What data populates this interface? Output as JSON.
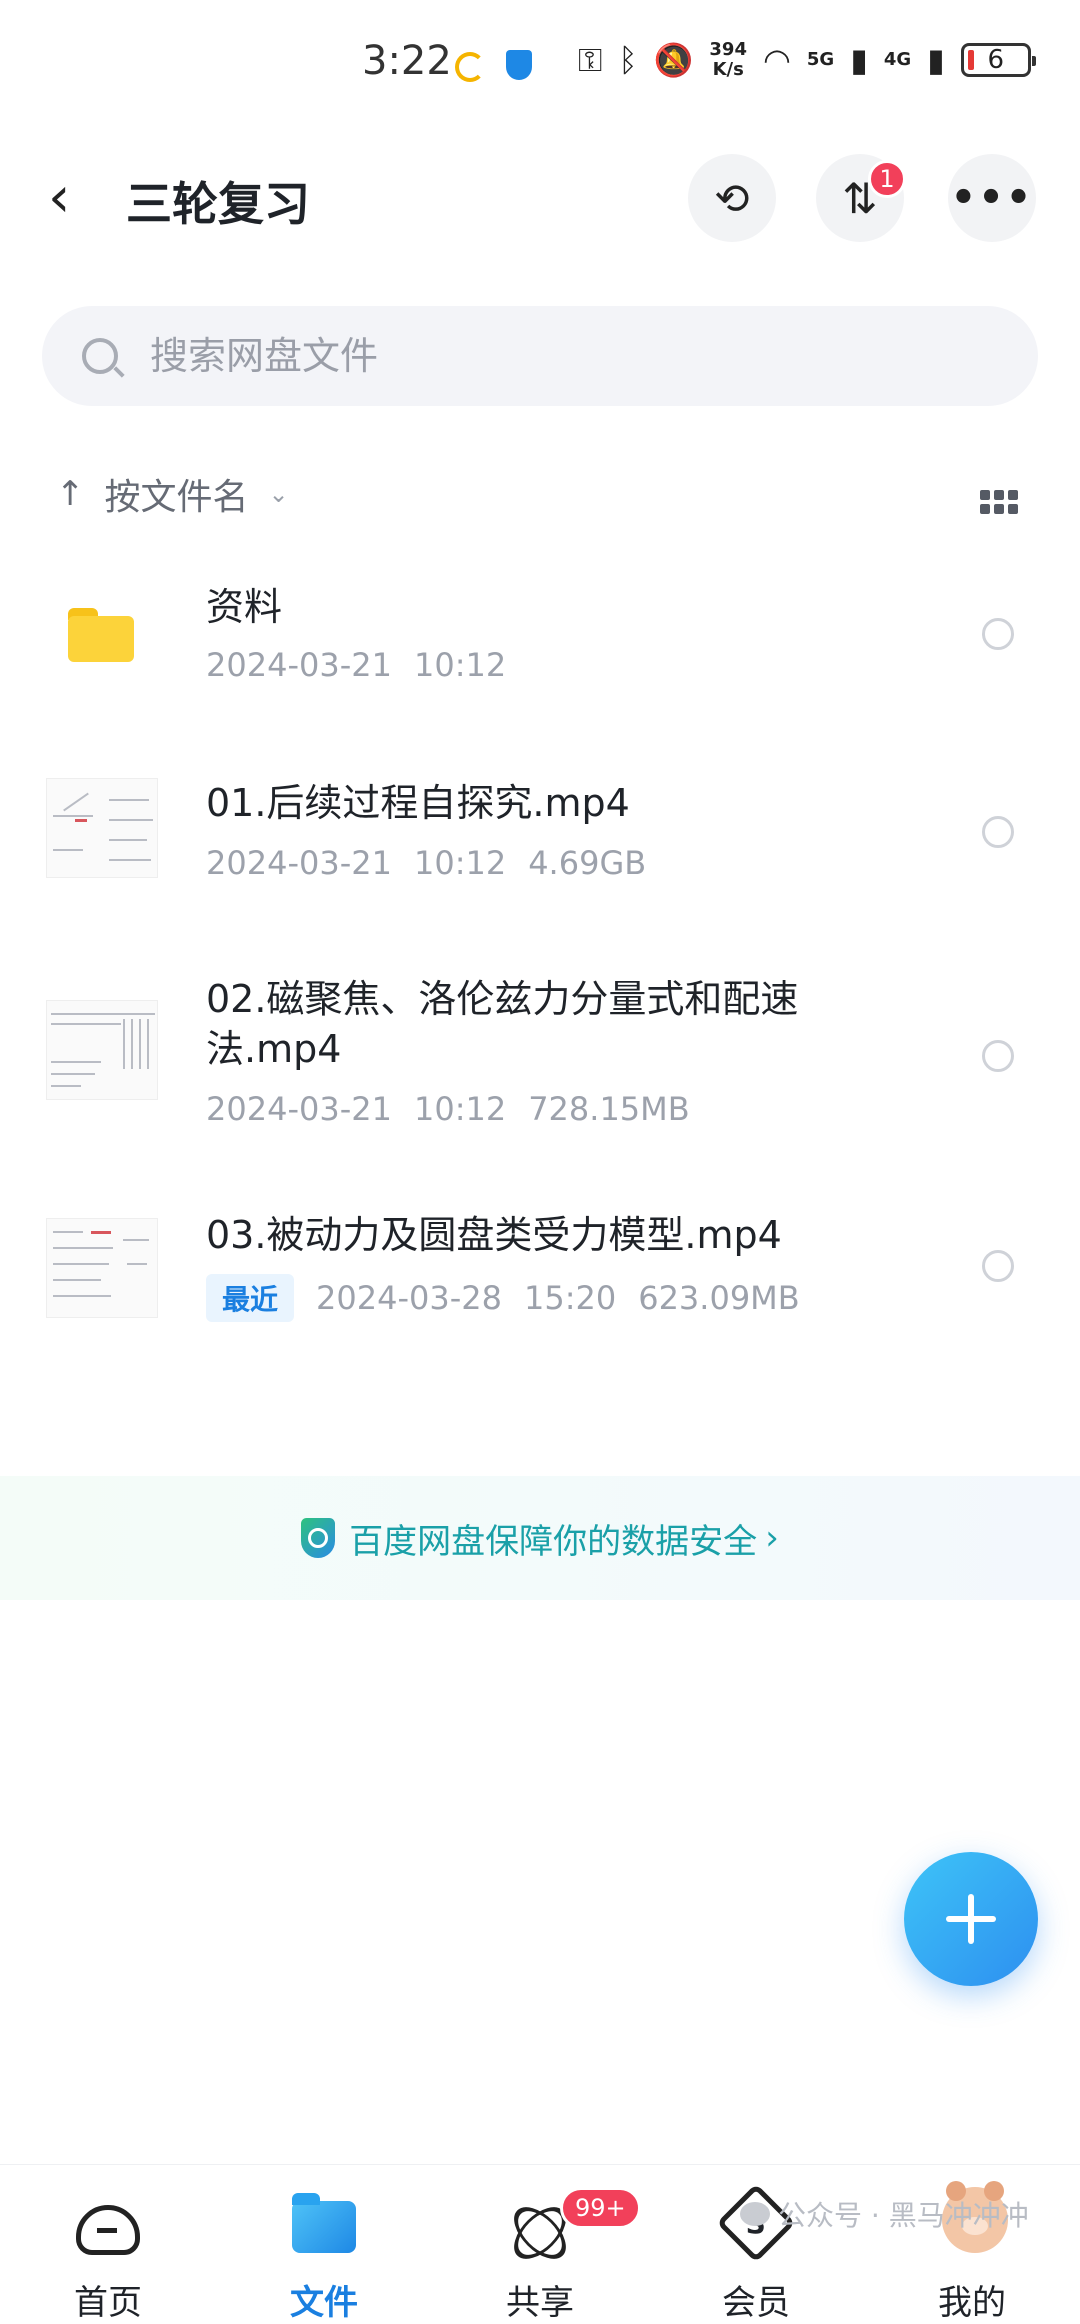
{
  "status_bar": {
    "time": "3:22",
    "net_speed_value": "394",
    "net_speed_unit": "K/s",
    "signal_1": "5G",
    "signal_2": "4G",
    "battery": "6"
  },
  "header": {
    "title": "三轮复习",
    "transfer_badge": "1",
    "more_label": "•••"
  },
  "search": {
    "placeholder": "搜索网盘文件"
  },
  "sort": {
    "label": "按文件名",
    "arrow": "↑",
    "chevron": "⌄"
  },
  "files": [
    {
      "name": "资料",
      "date": "2024-03-21",
      "time": "10:12",
      "size": "",
      "tag": ""
    },
    {
      "name": "01.后续过程自探究.mp4",
      "date": "2024-03-21",
      "time": "10:12",
      "size": "4.69GB",
      "tag": ""
    },
    {
      "name": "02.磁聚焦、洛伦兹力分量式和配速法.mp4",
      "date": "2024-03-21",
      "time": "10:12",
      "size": "728.15MB",
      "tag": ""
    },
    {
      "name": "03.被动力及圆盘类受力模型.mp4",
      "date": "2024-03-28",
      "time": "15:20",
      "size": "623.09MB",
      "tag": "最近"
    }
  ],
  "banner": {
    "text": "百度网盘保障你的数据安全",
    "chevron": "›"
  },
  "bottom_nav": [
    {
      "label": "首页"
    },
    {
      "label": "文件"
    },
    {
      "label": "共享",
      "badge": "99+"
    },
    {
      "label": "会员",
      "icon_letter": "S"
    },
    {
      "label": "我的"
    }
  ],
  "watermark": {
    "text": "公众号 · 黑马冲冲冲"
  },
  "colors": {
    "accent": "#1a7fe0",
    "badge": "#f2405a",
    "folder": "#fcd33a",
    "banner_text": "#1aa0a8"
  }
}
